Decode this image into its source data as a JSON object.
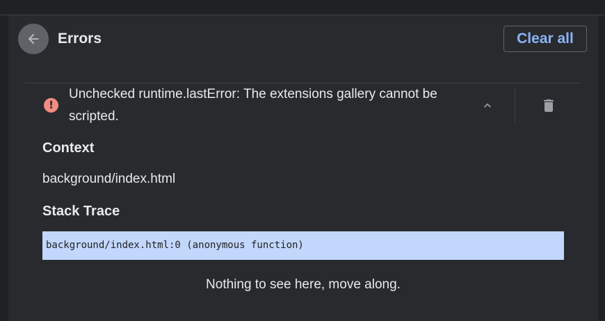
{
  "header": {
    "title": "Errors",
    "back_icon": "arrow-back-icon",
    "clear_all_label": "Clear all"
  },
  "error": {
    "icon": "error-icon",
    "icon_color": "#f28b82",
    "message": "Unchecked runtime.lastError: The extensions gallery cannot be scripted.",
    "collapse_icon": "chevron-up-icon",
    "delete_icon": "trash-icon"
  },
  "context": {
    "heading": "Context",
    "value": "background/index.html"
  },
  "stack_trace": {
    "heading": "Stack Trace",
    "frames": [
      "background/index.html:0 (anonymous function)"
    ],
    "highlight_color": "#c2d7fb"
  },
  "footer": {
    "note": "Nothing to see here, move along."
  },
  "colors": {
    "background": "#202124",
    "card": "#292a2d",
    "accent": "#8ab4f8"
  }
}
